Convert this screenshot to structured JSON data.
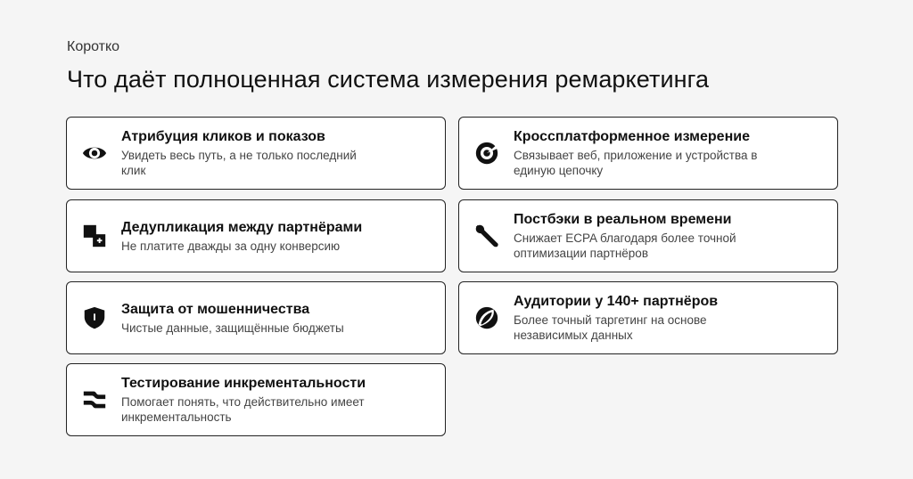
{
  "header": {
    "eyebrow": "Коротко",
    "title": "Что даёт полноценная система измерения ремаркетинга"
  },
  "cards": [
    {
      "title": "Атрибуция кликов и показов",
      "description": "Увидеть весь путь, а не только последний клик",
      "icon": "eye-icon"
    },
    {
      "title": "Кроссплатформенное измерение",
      "description": "Связывает веб, приложение и устройства в единую цепочку",
      "icon": "target-icon"
    },
    {
      "title": "Дедупликация между партнёрами",
      "description": "Не платите дважды за одну конверсию",
      "icon": "dedup-icon"
    },
    {
      "title": "Постбэки в реальном времени",
      "description": "Снижает ECPA благодаря более точной оптимизации партнёров",
      "icon": "wrench-icon"
    },
    {
      "title": "Защита от мошенничества",
      "description": "Чистые данные, защищённые бюджеты",
      "icon": "shield-icon"
    },
    {
      "title": "Аудитории у 140+ партнёров",
      "description": "Более точный таргетинг на основе независимых данных",
      "icon": "overlap-circles-icon"
    },
    {
      "title": "Тестирование инкрементальности",
      "description": "Помогает понять, что действительно имеет инкрементальность",
      "icon": "wave-icon"
    }
  ]
}
